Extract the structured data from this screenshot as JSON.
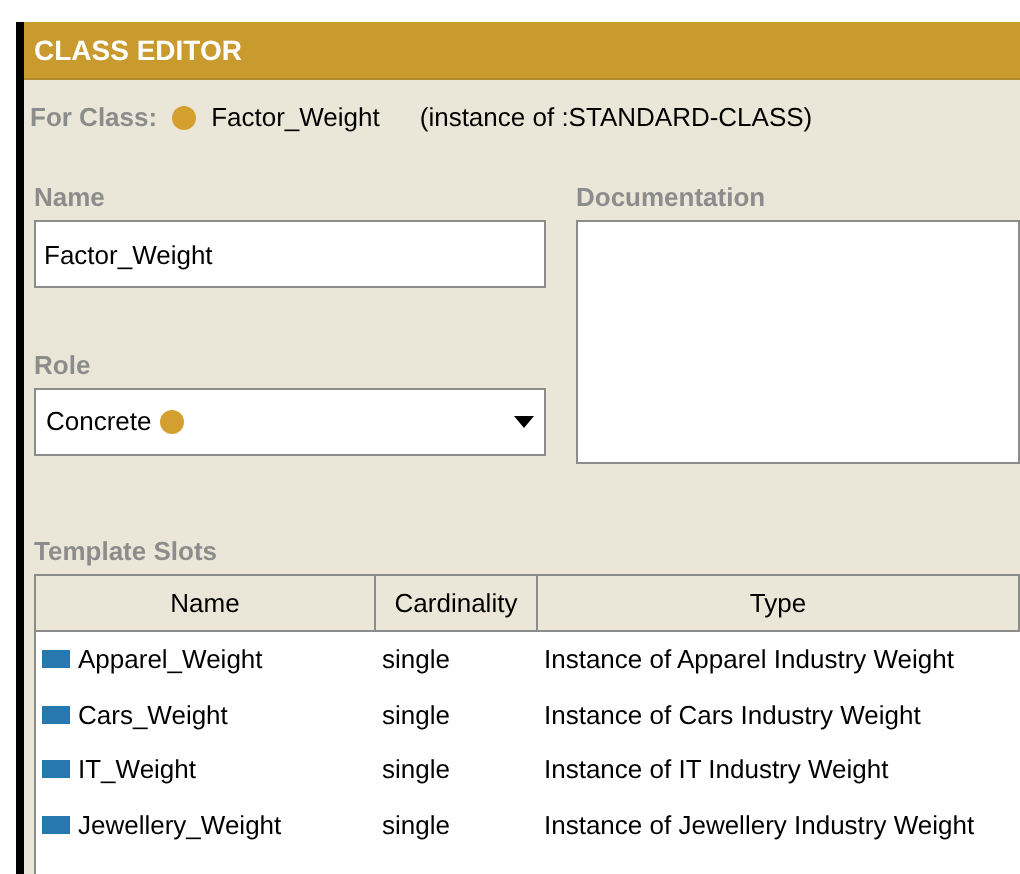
{
  "header": {
    "title": "CLASS EDITOR"
  },
  "for_class": {
    "label": "For Class:",
    "name": "Factor_Weight",
    "instance_of": "(instance of :STANDARD-CLASS)"
  },
  "name_field": {
    "label": "Name",
    "value": "Factor_Weight"
  },
  "documentation": {
    "label": "Documentation"
  },
  "role": {
    "label": "Role",
    "value": "Concrete"
  },
  "template_slots": {
    "label": "Template Slots",
    "columns": [
      "Name",
      "Cardinality",
      "Type"
    ],
    "rows": [
      {
        "name": "Apparel_Weight",
        "cardinality": "single",
        "type": "Instance of Apparel Industry Weight"
      },
      {
        "name": "Cars_Weight",
        "cardinality": "single",
        "type": "Instance of Cars Industry Weight"
      },
      {
        "name": "IT_Weight",
        "cardinality": "single",
        "type": "Instance of IT Industry Weight"
      },
      {
        "name": "Jewellery_Weight",
        "cardinality": "single",
        "type": "Instance of Jewellery Industry Weight"
      }
    ]
  }
}
